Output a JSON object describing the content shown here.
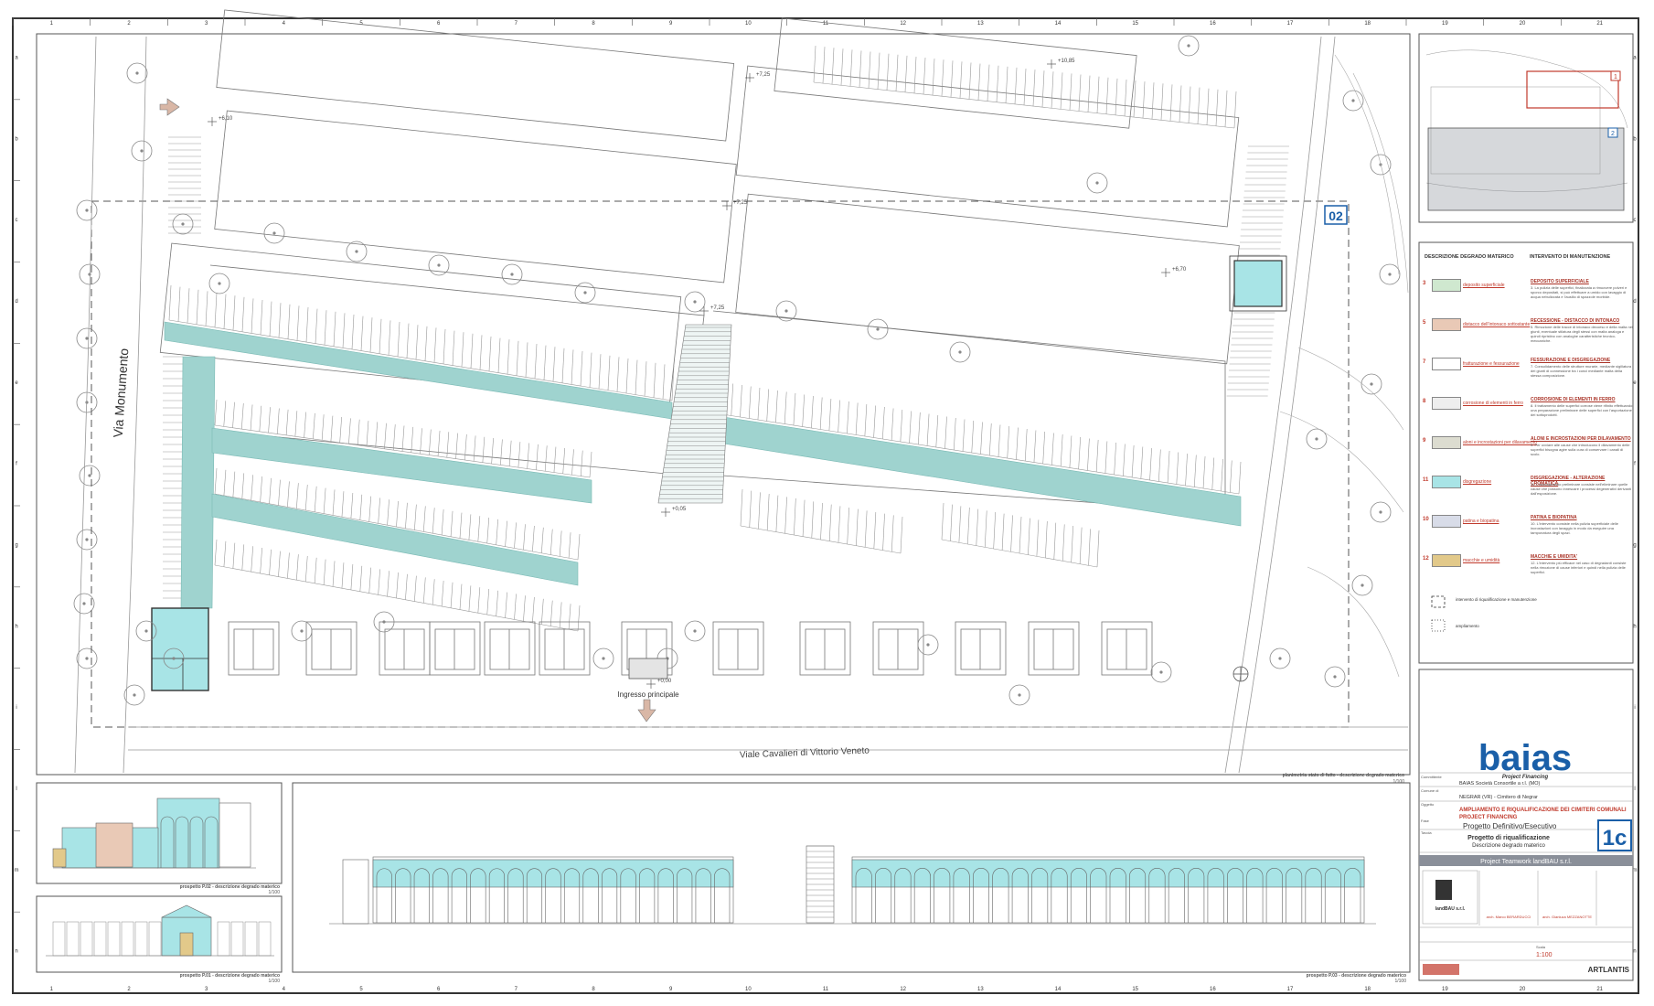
{
  "colors": {
    "teal": "#9fd3cf",
    "cyan_fill": "#a8e4e6",
    "brand_blue": "#1a5fa8",
    "accent_red": "#c0392b",
    "band_gray": "#8a8f99"
  },
  "grid": {
    "columns": [
      "1",
      "2",
      "3",
      "4",
      "5",
      "6",
      "7",
      "8",
      "9",
      "10",
      "11",
      "12",
      "13",
      "14",
      "15",
      "16",
      "17",
      "18",
      "19",
      "20",
      "21"
    ],
    "rows": [
      "a",
      "b",
      "c",
      "d",
      "e",
      "f",
      "g",
      "h",
      "i",
      "l",
      "m",
      "n"
    ]
  },
  "plan": {
    "street_left": "Via Monumento",
    "street_bottom": "Viale Cavalieri di Vittorio Veneto",
    "entrance_label": "Ingresso principale",
    "zone_tag": "02",
    "elevations": [
      "+7,25",
      "+10,85",
      "+6,10",
      "+7,25",
      "+7,25",
      "+6,70",
      "+0,05",
      "+0,00"
    ],
    "caption": "planimetria stato di fatto - descrizione degrado materico",
    "caption_scale": "1/100"
  },
  "elevation_views": {
    "p02_caption": "prospetto P.02 - descrizione degrado materico",
    "p02_scale": "1/100",
    "p01_caption": "prospetto P.01 - descrizione degrado materico",
    "p01_scale": "1/100",
    "p03_caption": "prospetto P.03 - descrizione degrado materico",
    "p03_scale": "1/100"
  },
  "legend": {
    "header_left": "DESCRIZIONE DEGRADO MATERICO",
    "header_right": "INTERVENTO DI MANUTENZIONE",
    "items": [
      {
        "num": "3",
        "label": "deposito superficiale",
        "title": "DEPOSITO SUPERFICIALE",
        "text": "3. La pulizia delle superfici, finalizzata a rimuovere polveri e sporco depositati, si può effettuare a umido con lavaggio di acqua nebulizzata e l'ausilio di spazzole morbide.",
        "color": "#cfe8cf"
      },
      {
        "num": "5",
        "label": "distacco dell'intonaco sottostante",
        "title": "RECESSIONE - DISTACCO DI INTONACO",
        "text": "5. Rimozione delle tracce di intonaco decoeso e della malta nei giunti, eventuale stilatura degli stessi con malta analoga e quindi ripristino con analoghe caratteristiche tecnico-meccaniche.",
        "color": "#e9c9b6"
      },
      {
        "num": "7",
        "label": "fratturazione e fessurazione",
        "title": "FESSURAZIONE E DISGREGAZIONE",
        "text": "7. Consolidamento delle strutture murarie, mediante sigillatura dei giunti di connessione tra i conci mediante malta della stessa composizione.",
        "color": "#ffffff"
      },
      {
        "num": "8",
        "label": "corrosione di elementi in ferro",
        "title": "CORROSIONE DI ELEMENTI IN FERRO",
        "text": "8. Il trattamento delle superfici corrose viene rifinito effettuando una preparazione preliminare delle superfici con l'asportazione dei sottoprodotti.",
        "color": "#eeeeee"
      },
      {
        "num": "9",
        "label": "aloni e incrostazioni per dilavamento",
        "title": "ALONI E INCROSTAZIONI PER DILAVAMENTO",
        "text": "9. Per ovviare alle cause che introducono il dilavamento delle superfici bisogna agire sulla cura di conservare i canali di scolo.",
        "color": "#dcdcd0"
      },
      {
        "num": "11",
        "label": "disgregazione",
        "title": "DISGREGAZIONE - ALTERAZIONE CROMATICA",
        "text": "11. L'accorgimento preliminare consiste nell'eliminare quelle cause che possono innescare i processi degenerativi derivanti dall'esposizione.",
        "color": "#a8e4e6"
      },
      {
        "num": "10",
        "label": "patina e biopatina",
        "title": "PATINA E BIOPATINA",
        "text": "10. L'intervento consiste nella pulizia superficiale delle incrostazioni con lavaggio in modo da eseguire una tamponatura degli spazi.",
        "color": "#d8dce8"
      },
      {
        "num": "12",
        "label": "macchie e umidità",
        "title": "MACCHIE E UMIDITA'",
        "text": "12. L'intervento più efficace nel caso di degradanti consiste nella rimozione di cause inferiori e quindi nella pulizia delle superfici.",
        "color": "#e2c98a"
      }
    ],
    "box_dashed": "intervento di riqualificazione e manutenzione",
    "box_dotted": "ampliamento"
  },
  "title_block": {
    "logo": "baias",
    "logo_sub": "Project Financing",
    "client_label": "Committente",
    "client": "BAIAS Società Consortile a r.l. (MO)",
    "comune_label": "Comune di",
    "comune": "NEGRAR (VR) - Cimitero di Negrar",
    "oggetto_label": "Oggetto",
    "oggetto_1": "AMPLIAMENTO E RIQUALIFICAZIONE DEI CIMITERI COMUNALI",
    "oggetto_2": "PROJECT FINANCING",
    "fase_label": "Fase",
    "fase": "Progetto Definitivo/Esecutivo",
    "tavola_label": "Tavola",
    "tavola_1": "Progetto di riqualificazione",
    "tavola_2": "Descrizione degrado materico",
    "sheet_code": "1c",
    "team": "Project Teamwork landBAU s.r.l.",
    "studio": "landBAU s.r.l.",
    "architect_1": "arch. Marco BERARDUCCI",
    "architect_2": "arch. Gianluca MEZZANOTTE",
    "scale_label": "Scala",
    "scale": "1:100",
    "brand": "ARTLANTIS"
  }
}
